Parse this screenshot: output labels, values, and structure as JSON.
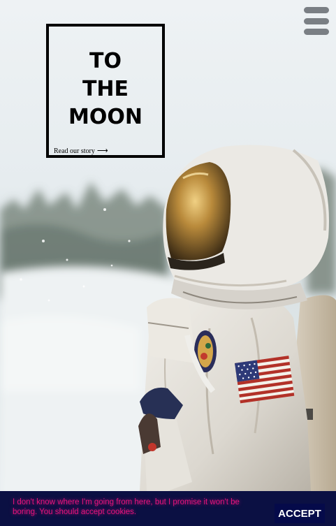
{
  "title_lines": [
    "TO",
    "THE",
    "MOON"
  ],
  "story_link": {
    "label": "Read our story",
    "arrow": "⟶"
  },
  "menu": {
    "icon": "hamburger-menu-icon"
  },
  "cookie_banner": {
    "message": "I don't know where I'm going from here, but I promise it won't be boring. You should accept cookies.",
    "accept_label": "ACCEPT"
  },
  "colors": {
    "banner_background": "#0b1043",
    "banner_text": "#e5147c",
    "accept_background": "#050a4a",
    "title": "#000000"
  }
}
